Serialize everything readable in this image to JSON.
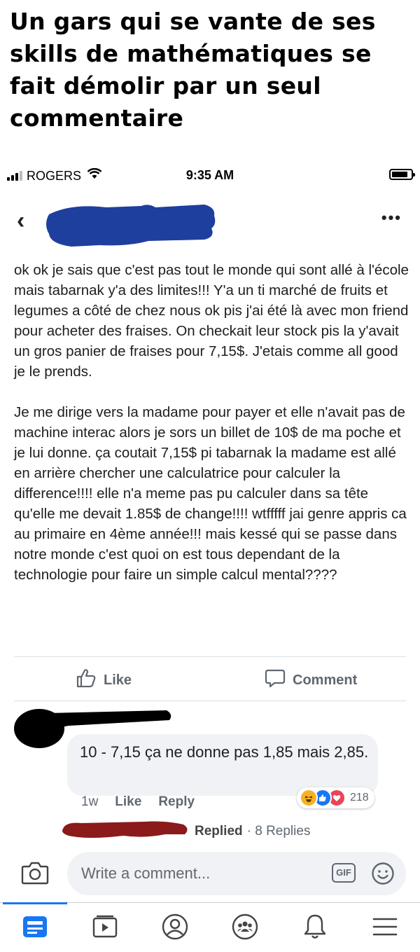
{
  "meme_title": "Un gars qui se vante de ses skills de mathématiques se fait démolir par un seul commentaire",
  "status_bar": {
    "carrier": "ROGERS",
    "time": "9:35 AM"
  },
  "post": {
    "paragraphs": [
      "ok ok je sais que c'est pas tout le monde qui sont allé à l'école mais tabarnak y'a des limites!!! Y'a un ti marché de fruits et legumes a côté de chez nous ok pis j'ai été là avec mon friend pour acheter des fraises. On checkait leur stock pis la y'avait un gros panier de fraises pour 7,15$. J'etais comme all good je le prends.",
      "Je me dirige vers la madame pour payer et elle n'avait pas de machine interac alors je sors un billet de 10$ de ma poche et je lui donne. ça coutait 7,15$ pi tabarnak la madame est allé en arrière chercher une calculatrice pour calculer la difference!!!! elle n'a meme pas pu calculer dans sa tête qu'elle me devait 1.85$ de change!!!! wtfffff jai genre appris ca au primaire en 4ème année!!! mais kessé qui se passe dans notre monde c'est quoi on est tous dependant de la technologie pour faire un simple calcul mental????"
    ],
    "actions": {
      "like": "Like",
      "comment": "Comment"
    }
  },
  "comment": {
    "text": "10 - 7,15 ça ne donne pas 1,85 mais 2,85.",
    "time": "1w",
    "like": "Like",
    "reply": "Reply",
    "reaction_count": "218",
    "reactions": [
      "haha-icon",
      "like-icon",
      "love-icon"
    ],
    "replies_label": "Replied",
    "replies_count": "· 8 Replies"
  },
  "composer": {
    "placeholder": "Write a comment...",
    "gif": "GIF"
  },
  "colors": {
    "accent": "#1877f2",
    "redaction_blue": "#1f3f9e",
    "redaction_black": "#000000",
    "redaction_red": "#8b1a1a"
  }
}
